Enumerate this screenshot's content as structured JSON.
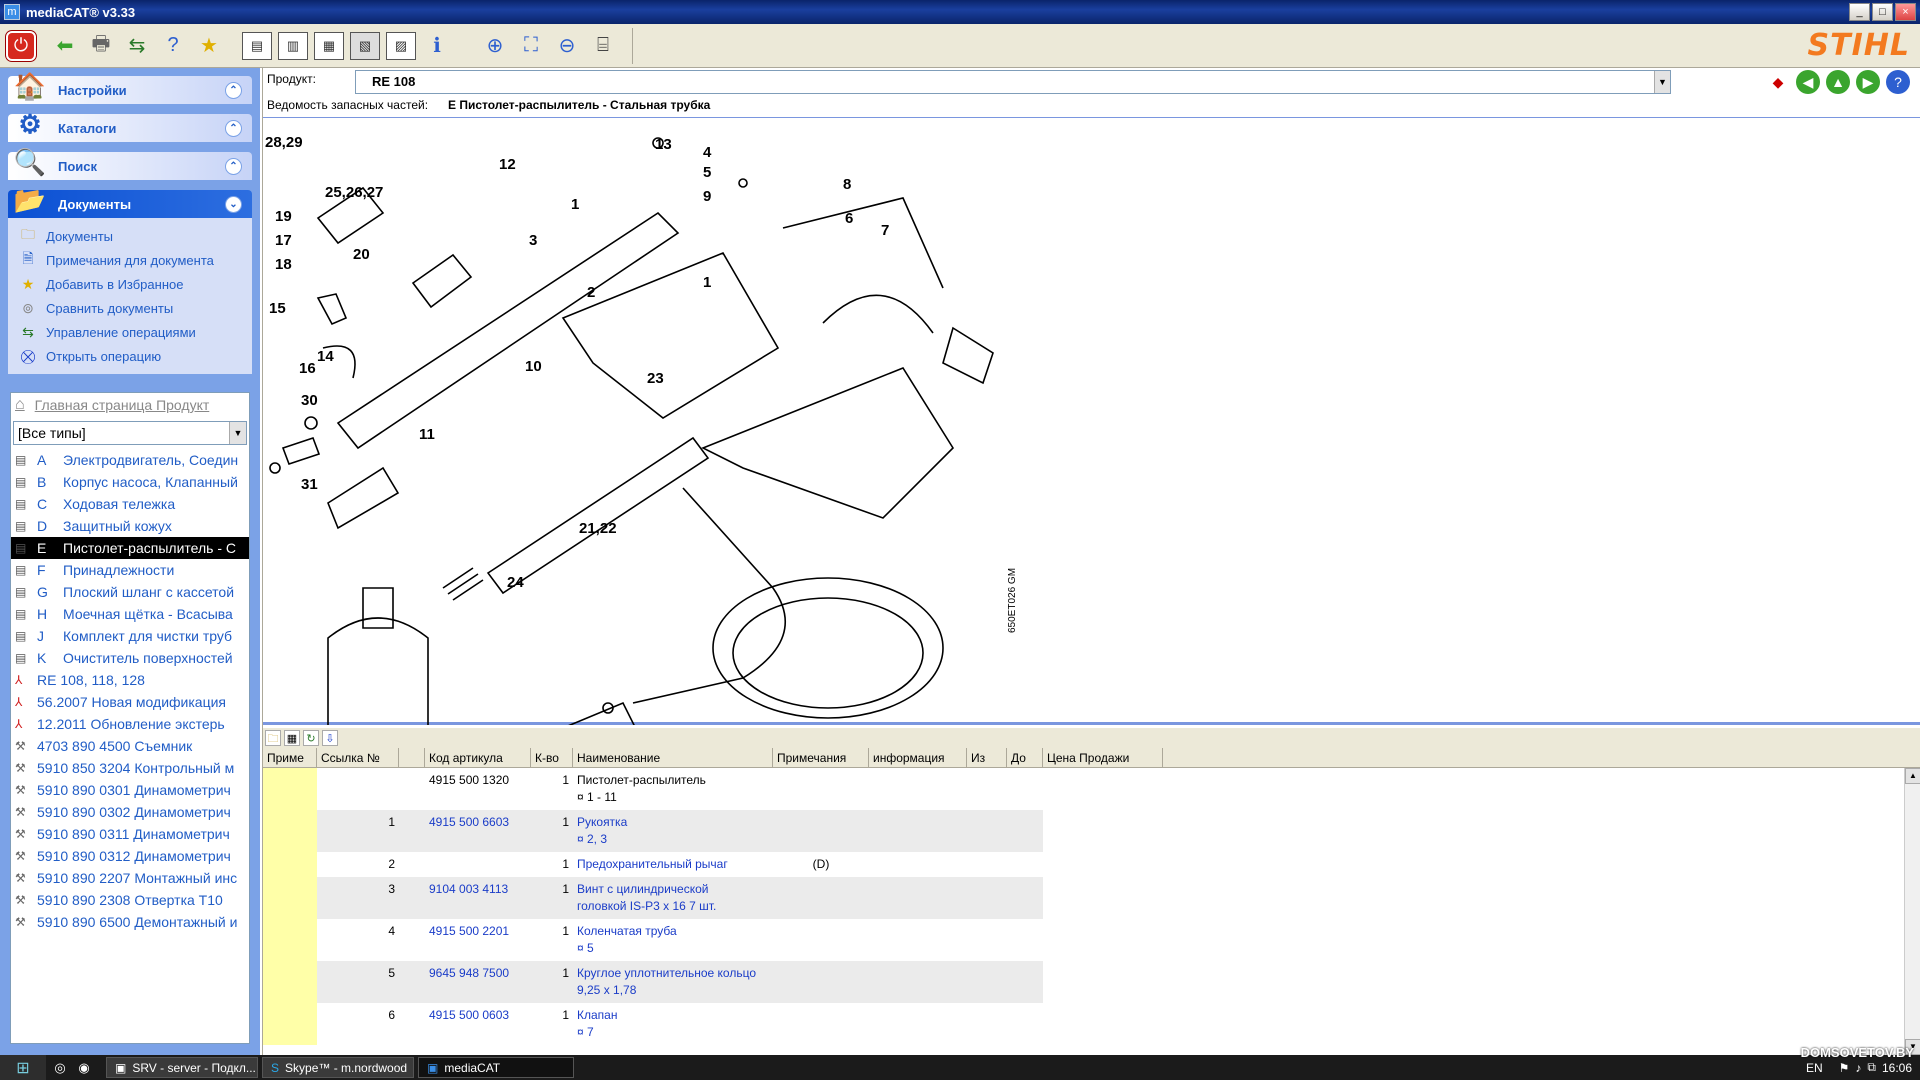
{
  "window": {
    "title": "mediaCAT® v3.33",
    "buttons": [
      "_",
      "□",
      "×"
    ]
  },
  "toolbar": {
    "logo": "STIHL"
  },
  "left": {
    "sections": [
      {
        "id": "settings",
        "label": "Настройки",
        "icon": "house-icon",
        "expanded": false
      },
      {
        "id": "catalogs",
        "label": "Каталоги",
        "icon": "gear-icon",
        "expanded": false
      },
      {
        "id": "search",
        "label": "Поиск",
        "icon": "magnifier-icon",
        "expanded": false
      },
      {
        "id": "documents",
        "label": "Документы",
        "icon": "folder-icon",
        "expanded": true
      }
    ],
    "doc_items": [
      {
        "label": "Документы",
        "icon": "folder-icon"
      },
      {
        "label": "Примечания для документа",
        "icon": "notes-icon"
      },
      {
        "label": "Добавить в Избранное",
        "icon": "star-icon"
      },
      {
        "label": "Сравнить документы",
        "icon": "compare-icon"
      },
      {
        "label": "Управление операциями",
        "icon": "arrows-icon"
      },
      {
        "label": "Открыть операцию",
        "icon": "cart-icon"
      }
    ],
    "tree": {
      "home": "Главная страница Продукт",
      "filter": "[Все типы]",
      "rows": [
        {
          "type": "doc",
          "letter": "A",
          "text": "Электродвигатель, Соедин"
        },
        {
          "type": "doc",
          "letter": "B",
          "text": "Корпус насоса, Клапанный"
        },
        {
          "type": "doc",
          "letter": "C",
          "text": "Ходовая тележка"
        },
        {
          "type": "doc",
          "letter": "D",
          "text": "Защитный кожух"
        },
        {
          "type": "doc",
          "letter": "E",
          "text": "Пистолет-распылитель - С",
          "selected": true
        },
        {
          "type": "doc",
          "letter": "F",
          "text": "Принадлежности"
        },
        {
          "type": "doc",
          "letter": "G",
          "text": "Плоский шланг с кассетой"
        },
        {
          "type": "doc",
          "letter": "H",
          "text": "Моечная щётка - Всасыва"
        },
        {
          "type": "doc",
          "letter": "J",
          "text": "Комплект для чистки труб"
        },
        {
          "type": "doc",
          "letter": "K",
          "text": "Очиститель поверхностей"
        },
        {
          "type": "pdf",
          "letter": "",
          "text": "RE 108, 118, 128"
        },
        {
          "type": "pdf",
          "letter": "",
          "text": "56.2007 Новая модификация"
        },
        {
          "type": "pdf",
          "letter": "",
          "text": "12.2011 Обновление экстерь"
        },
        {
          "type": "tool",
          "letter": "",
          "text": "4703 890 4500  Съемник"
        },
        {
          "type": "tool",
          "letter": "",
          "text": "5910 850 3204  Контрольный м"
        },
        {
          "type": "tool",
          "letter": "",
          "text": "5910 890 0301  Динамометрич"
        },
        {
          "type": "tool",
          "letter": "",
          "text": "5910 890 0302  Динамометрич"
        },
        {
          "type": "tool",
          "letter": "",
          "text": "5910 890 0311  Динамометрич"
        },
        {
          "type": "tool",
          "letter": "",
          "text": "5910 890 0312  Динамометрич"
        },
        {
          "type": "tool",
          "letter": "",
          "text": "5910 890 2207  Монтажный инс"
        },
        {
          "type": "tool",
          "letter": "",
          "text": "5910 890 2308  Отвертка T10"
        },
        {
          "type": "tool",
          "letter": "",
          "text": "5910 890 6500  Демонтажный и"
        }
      ]
    }
  },
  "header": {
    "product_label": "Продукт:",
    "product_value": "RE 108",
    "sheet_label": "Ведомость запасных частей:",
    "sheet_value": "E  Пистолет-распылитель - Стальная трубка"
  },
  "drawing": {
    "callouts": [
      "28,29",
      "12",
      "13",
      "4",
      "5",
      "8",
      "25,26,27",
      "1",
      "9",
      "6",
      "19",
      "3",
      "7",
      "17",
      "18",
      "20",
      "2",
      "1",
      "15",
      "14",
      "16",
      "10",
      "23",
      "30",
      "11",
      "31",
      "21,22",
      "24"
    ],
    "code": "650ET026 GM"
  },
  "grid": {
    "columns": [
      "Приме",
      "Ссылка №",
      "",
      "Код артикула",
      "К-во",
      "Наименование",
      "Примечания",
      "информация",
      "Из",
      "До",
      "Цена Продажи"
    ],
    "rows": [
      {
        "ref": "",
        "code": "4915 500 1320",
        "qty": "1",
        "name": "Пистолет-распылитель\n¤ 1 - 11",
        "note": "",
        "link": false
      },
      {
        "ref": "1",
        "code": "4915 500 6603",
        "qty": "1",
        "name": "Рукоятка\n¤ 2, 3",
        "note": "",
        "link": true
      },
      {
        "ref": "2",
        "code": "",
        "qty": "1",
        "name": "Предохранительный рычаг",
        "note": "(D)",
        "link": true
      },
      {
        "ref": "3",
        "code": "9104 003 4113",
        "qty": "1",
        "name": "Винт с цилиндрической\nголовкой IS-P3 x 16  7 шт.\n ",
        "note": "",
        "link": true
      },
      {
        "ref": "4",
        "code": "4915 500 2201",
        "qty": "1",
        "name": "Коленчатая труба\n¤ 5",
        "note": "",
        "link": true
      },
      {
        "ref": "5",
        "code": "9645 948 7500",
        "qty": "1",
        "name": "Круглое уплотнительное кольцо\n9,25 x 1,78",
        "note": "",
        "link": true
      },
      {
        "ref": "6",
        "code": "4915 500 0603",
        "qty": "1",
        "name": "Клапан\n¤ 7",
        "note": "",
        "link": true
      }
    ]
  },
  "taskbar": {
    "tasks": [
      "SRV - server - Подкл...",
      "Skype™ - m.nordwood",
      "mediaCAT"
    ],
    "lang": "EN",
    "time": "16:06"
  },
  "watermark": "DOMSOVETOV.BY"
}
